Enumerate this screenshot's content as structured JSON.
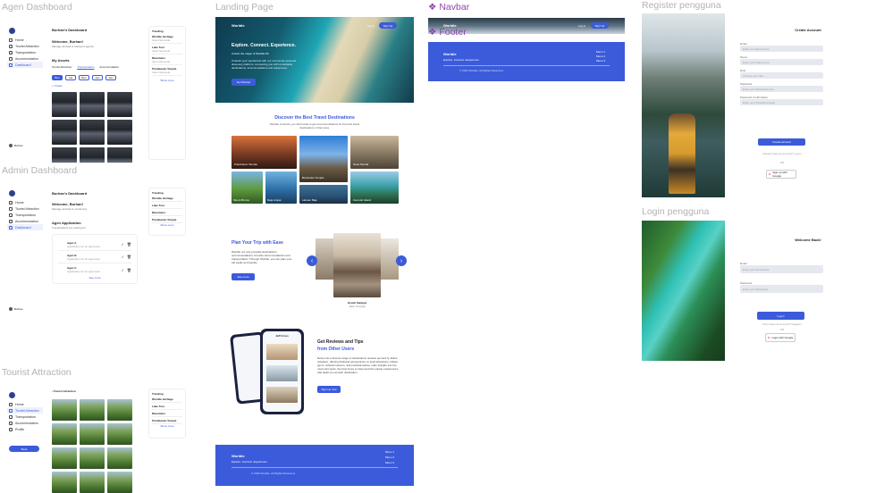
{
  "frames": {
    "agen": "Agen Dashboard",
    "admin": "Admin Dashboard",
    "tourist": "Tourist Attraction",
    "landing": "Landing Page",
    "navbar": "Navbar",
    "footer": "Footer",
    "register": "Register pengguna",
    "login": "Login pengguna"
  },
  "agen": {
    "header": "Burhan's Dashboard",
    "welcome": "Welcome, Burhan!",
    "sub": "Manage all data & transport agents",
    "assets_title": "My Assets",
    "tabs": [
      "Tourist Attraction",
      "Transportation",
      "Accommodation"
    ],
    "chips": [
      "Bus",
      "Car",
      "Bus",
      "Van",
      "Van"
    ],
    "add": "+ Create",
    "user": "Burhan",
    "sidebar": [
      "Home",
      "Tourist Attraction",
      "Transportation",
      "Accommodation",
      "Dashboard"
    ]
  },
  "admin": {
    "header": "Burhan's Dashboard",
    "welcome": "Welcome, Burhan!",
    "sub": "Manage all data & monitoring",
    "section": "Agen Application",
    "section_sub": "3 applications are waiting for",
    "items": [
      {
        "name": "Agen A",
        "desc": "Application for an approved"
      },
      {
        "name": "Agen B",
        "desc": "Application for an approved"
      },
      {
        "name": "Agen C",
        "desc": "Application for an approved"
      }
    ],
    "see_more": "See more",
    "user": "Burhan",
    "sidebar": [
      "Home",
      "Tourist Attraction",
      "Transportation",
      "Accommodation",
      "Dashboard"
    ]
  },
  "tourist": {
    "title": "Tourist Attraction",
    "sidebar": [
      "Home",
      "Tourist Attraction",
      "Transportation",
      "Accommodation",
      "Profile"
    ],
    "button": "Book"
  },
  "trending": {
    "title": "Trending",
    "items": [
      {
        "name": "Worldie Heritage",
        "sub": "Open",
        "loc": "Java Indonesia"
      },
      {
        "name": "Lake Tour",
        "sub": "Open",
        "loc": "Java Indonesia"
      },
      {
        "name": "Mountains",
        "sub": "Open",
        "loc": "Java Indonesia"
      },
      {
        "name": "Borobudur",
        "sub": "Open",
        "loc": "Java Indonesia"
      },
      {
        "name": "Prambanan Temple",
        "sub": "Open",
        "loc": "Java Indonesia"
      }
    ],
    "see_all": "Show more"
  },
  "landing": {
    "brand": "Worldie",
    "nav_login": "Log in",
    "nav_signup": "Sign Up",
    "hero_title": "Explore. Connect. Experience.",
    "hero_sub": "Unlock the magic of Worldie.ID!",
    "hero_desc": "Unleash your wanderlust with our community-powered discovery platform, connecting you with remarkable destinations, accommodations and adventures.",
    "hero_btn": "Get Started",
    "dest_title": "Discover the Best Travel Destinations",
    "dest_sub": "Worldie connects you with locals to get recommendations for the best travel destinations in their area.",
    "destinations": [
      "Prambanan Temple",
      "Borobudur Temple",
      "Nusa Penida",
      "Mount Bromo",
      "Raja Ampat",
      "Labuan Bajo",
      "Komodo Island"
    ],
    "plan_title": "Plan Your Trip with Ease",
    "plan_desc": "Worldie not only provides destinations recommendations, but also accommodations and transportation. Through Worldie, you can plan your trip easily and quickly.",
    "plan_btn": "See more",
    "hotel_name": "Hostel Sanjaya",
    "hotel_loc": "Jalan Sunyaja",
    "review_title_1": "Get Reviews and Tips",
    "review_title_2": "from Other Users",
    "review_desc": "Delve into a diverse range of destinations reviews penned by fellow travellers, offering firsthand perspectives on local attractions, hidden gems, cultural customs, and practical advice. Gain insights into the must-visit spots, the best times to travel and the unique experiences that await you at each destination.",
    "review_btn": "Sign Up now",
    "phone_header": "Jeff Cross"
  },
  "footer": {
    "brand": "Worldie",
    "tagline": "Explore. Connect. Experience.",
    "menus": [
      "Menu 1",
      "Menu 2",
      "Menu 3"
    ],
    "copy": "© 2023 Worldie. All Rights Reserved."
  },
  "navbar": {
    "brand": "Worldie",
    "login": "Log in",
    "signup": "Sign Up"
  },
  "register": {
    "title": "Create Account",
    "fields": [
      {
        "label": "Email",
        "placeholder": "Enter your Email Here"
      },
      {
        "label": "Name",
        "placeholder": "Enter your Name here"
      },
      {
        "label": "Role",
        "placeholder": "Choose your role"
      },
      {
        "label": "Password",
        "placeholder": "Enter your Password here"
      },
      {
        "label": "Password Confirmation",
        "placeholder": "Enter your Password Again"
      }
    ],
    "button": "Create Account",
    "have_account": "Already have an account? Log in",
    "or": "OR",
    "google": "Sign up with Google"
  },
  "login": {
    "title": "Welcome Back!",
    "fields": [
      {
        "label": "Email",
        "placeholder": "Enter your Email Here"
      },
      {
        "label": "Password",
        "placeholder": "Enter your Password"
      }
    ],
    "button": "Log in",
    "no_account": "Don't have an account? Register",
    "or": "OR",
    "google": "Login with Google"
  },
  "colors": {
    "primary": "#3b5bdb",
    "navbar_title": "#8e44ad",
    "frame_title": "#b3b3b3"
  }
}
